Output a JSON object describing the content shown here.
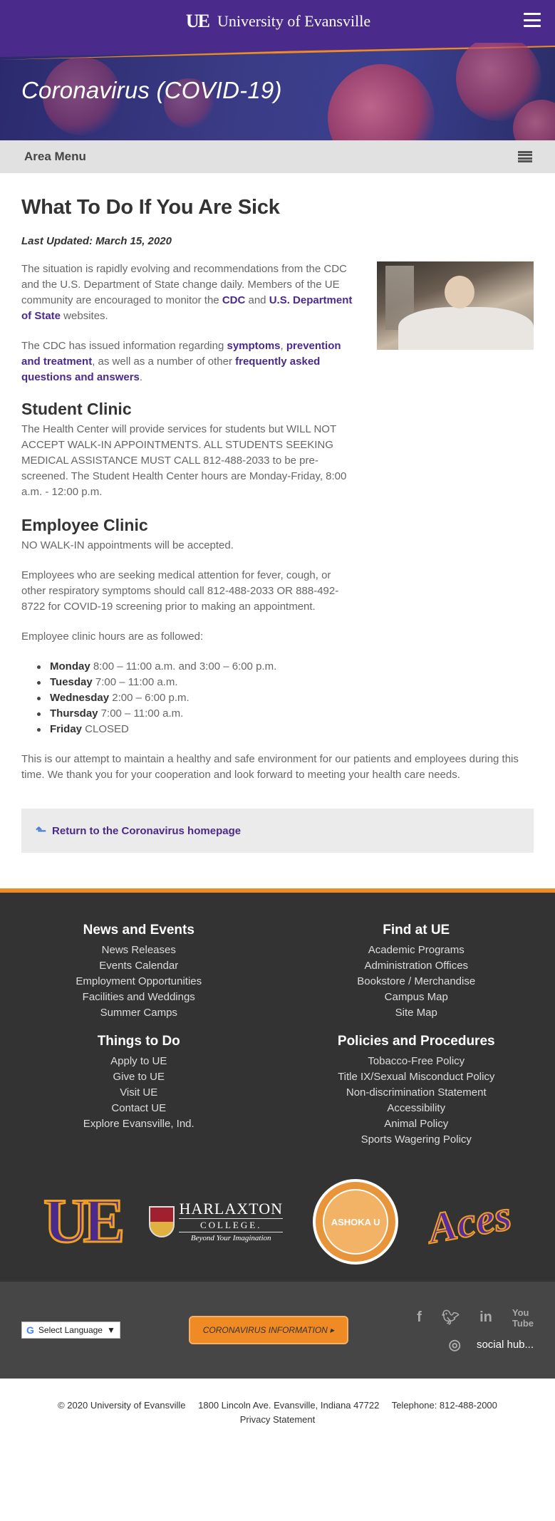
{
  "header": {
    "logo_text": "UE",
    "site_name": "University of Evansville",
    "menu_icon": "hamburger-menu-icon"
  },
  "hero": {
    "title": "Coronavirus (COVID-19)"
  },
  "area_menu": {
    "label": "Area Menu",
    "icon": "hamburger-menu-icon"
  },
  "main": {
    "title": "What To Do If You Are Sick",
    "last_updated": "Last Updated: March 15, 2020",
    "intro_p1_text1": "The situation is rapidly evolving and recommendations from the CDC and the U.S. Department of State change daily. Members of the UE community are encouraged to monitor the ",
    "intro_p1_link1": "CDC",
    "intro_p1_text2": " and ",
    "intro_p1_link2": "U.S. Department of State",
    "intro_p1_text3": " websites.",
    "intro_p2_text1": "The CDC has issued information regarding ",
    "intro_p2_link1": "symptoms",
    "intro_p2_text2": ", ",
    "intro_p2_link2": "prevention and treatment",
    "intro_p2_text3": ", as well as a number of other ",
    "intro_p2_link3": "frequently asked questions and answers",
    "intro_p2_text4": ".",
    "student_clinic": {
      "heading": "Student Clinic",
      "body": "The Health Center will provide services for students but WILL NOT ACCEPT WALK-IN APPOINTMENTS. ALL STUDENTS SEEKING MEDICAL ASSISTANCE MUST CALL 812-488-2033 to be pre-screened. The Student Health Center hours are Monday-Friday, 8:00 a.m. - 12:00 p.m."
    },
    "employee_clinic": {
      "heading": "Employee Clinic",
      "p1": "NO WALK-IN appointments will be accepted.",
      "p2": "Employees who are seeking medical attention for fever, cough, or other respiratory symptoms should call 812-488-2033 OR 888-492-8722 for COVID-19 screening prior to making an appointment.",
      "p3": "Employee clinic hours are as followed:",
      "hours": [
        {
          "day": "Monday",
          "time": " 8:00 – 11:00 a.m. and 3:00 – 6:00 p.m."
        },
        {
          "day": "Tuesday",
          "time": " 7:00 – 11:00 a.m."
        },
        {
          "day": "Wednesday",
          "time": " 2:00 – 6:00 p.m."
        },
        {
          "day": "Thursday",
          "time": " 7:00 – 11:00 a.m."
        },
        {
          "day": "Friday",
          "time": " CLOSED"
        }
      ]
    },
    "closing": "This is our attempt to maintain a healthy and safe environment for our patients and employees during this time. We thank you for your cooperation and look forward to meeting your health care needs.",
    "return_link": "Return to the Coronavirus homepage"
  },
  "footer": {
    "news": {
      "heading": "News and Events",
      "links": [
        "News Releases",
        "Events Calendar",
        "Employment Opportunities",
        "Facilities and Weddings",
        "Summer Camps"
      ]
    },
    "find": {
      "heading": "Find at UE",
      "links": [
        "Academic Programs",
        "Administration Offices",
        "Bookstore / Merchandise",
        "Campus Map",
        "Site Map"
      ]
    },
    "things": {
      "heading": "Things to Do",
      "links": [
        "Apply to UE",
        "Give to UE",
        "Visit UE",
        "Contact UE",
        "Explore Evansville, Ind."
      ]
    },
    "policies": {
      "heading": "Policies and Procedures",
      "links": [
        "Tobacco-Free Policy",
        "Title IX/Sexual Misconduct Policy",
        "Non-discrimination Statement",
        "Accessibility",
        "Animal Policy",
        "Sports Wagering Policy"
      ]
    },
    "logos": {
      "ue": "UE",
      "harlaxton_name": "HARLAXTON",
      "harlaxton_college": "COLLEGE.",
      "harlaxton_tag": "Beyond Your Imagination",
      "ashoka": "ASHOKA U",
      "aces": "Aces"
    },
    "utility": {
      "language": "Select Language",
      "covid_button": "CORONAVIRUS INFORMATION ▸",
      "social_hub": "social hub..."
    },
    "bottom": {
      "copyright": "© 2020 University of Evansville",
      "address": "1800 Lincoln Ave. Evansville, Indiana 47722",
      "phone": "Telephone: 812-488-2000",
      "privacy": "Privacy Statement"
    }
  }
}
